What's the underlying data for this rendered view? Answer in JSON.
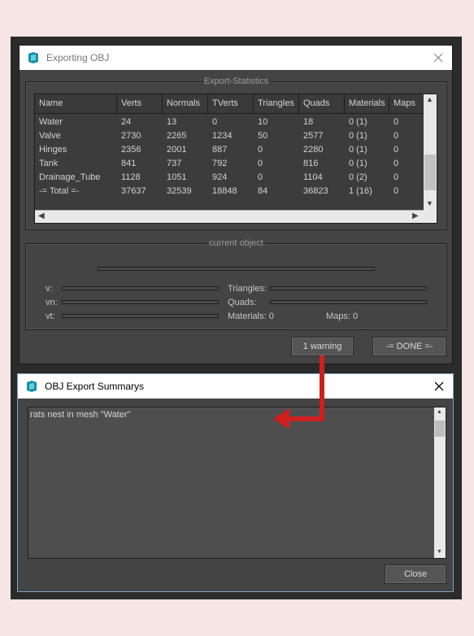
{
  "export_window": {
    "title": "Exporting OBJ",
    "stats_group_label": "Export-Statistics",
    "columns": [
      "Name",
      "Verts",
      "Normals",
      "TVerts",
      "Triangles",
      "Quads",
      "Materials",
      "Maps"
    ],
    "rows": [
      [
        "Water",
        "24",
        "13",
        "0",
        "10",
        "18",
        "0 (1)",
        "0"
      ],
      [
        "Valve",
        "2730",
        "2265",
        "1234",
        "50",
        "2577",
        "0 (1)",
        "0"
      ],
      [
        "Hinges",
        "2356",
        "2001",
        "887",
        "0",
        "2280",
        "0 (1)",
        "0"
      ],
      [
        "Tank",
        "841",
        "737",
        "792",
        "0",
        "816",
        "0 (1)",
        "0"
      ],
      [
        "Drainage_Tube",
        "1128",
        "1051",
        "924",
        "0",
        "1104",
        "0 (2)",
        "0"
      ],
      [
        "-= Total =-",
        "37637",
        "32539",
        "18848",
        "84",
        "36823",
        "1 (16)",
        "0"
      ]
    ],
    "current_object_label": "current object",
    "v_label": "v:",
    "vn_label": "vn:",
    "vt_label": "vt:",
    "triangles_label": "Triangles:",
    "quads_label": "Quads:",
    "materials_text": "Materials: 0",
    "maps_text": "Maps:  0",
    "warning_button": "1 warning",
    "done_button": "-= DONE =-"
  },
  "summary_window": {
    "title": "OBJ Export Summarys",
    "message": "rats nest in mesh \"Water\"",
    "close_button": "Close"
  },
  "colors": {
    "annotation_arrow": "#d01f1f",
    "page_background": "#f7e4e4",
    "dialog_background": "#444444"
  },
  "icons": {
    "app": "3dsmax-app-icon",
    "close": "close-icon",
    "arrow": "red-callout-arrow"
  }
}
